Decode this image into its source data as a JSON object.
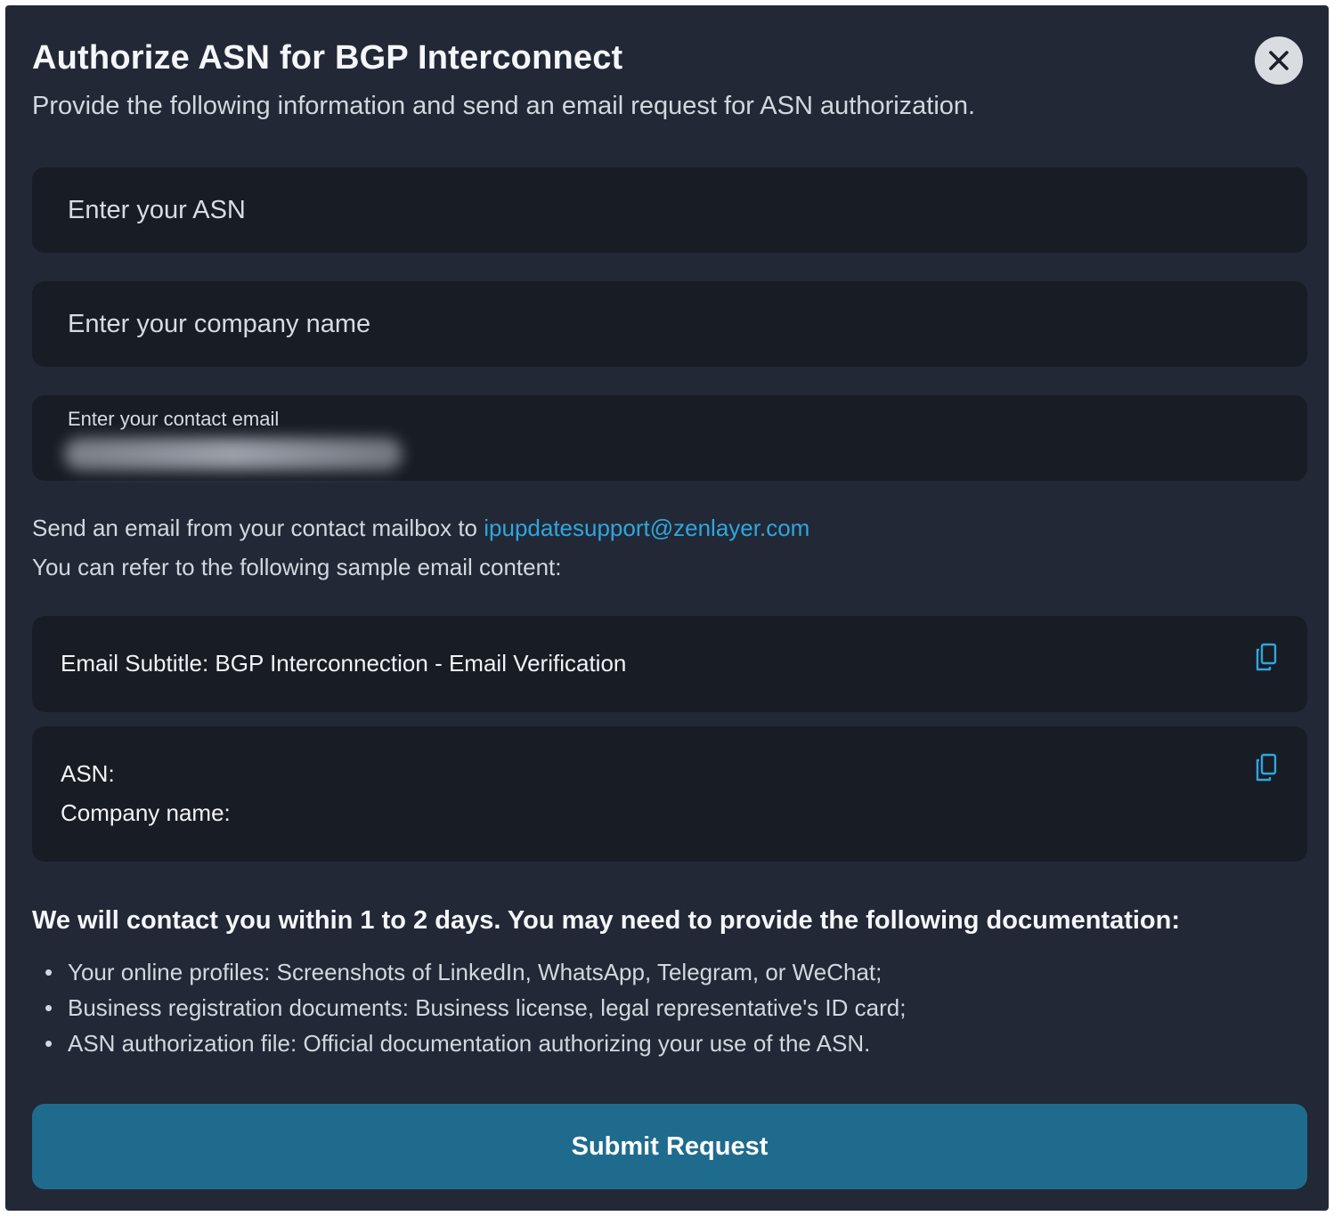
{
  "dialog": {
    "title": "Authorize ASN for BGP Interconnect",
    "subtitle": "Provide the following information and send an email request for ASN authorization.",
    "close_icon": "close-icon"
  },
  "form": {
    "asn": {
      "placeholder": "Enter your ASN",
      "value": ""
    },
    "company": {
      "placeholder": "Enter your company name",
      "value": ""
    },
    "email": {
      "label": "Enter your contact email",
      "value_state": "blurred"
    }
  },
  "instructions": {
    "send_prefix": "Send an email from your contact mailbox to ",
    "support_email": "ipupdatesupport@zenlayer.com",
    "refer_text": "You can refer to the following sample email content:"
  },
  "samples": {
    "subject_line": "Email Subtitle: BGP Interconnection - Email Verification",
    "body_line_1": "ASN:",
    "body_line_2": "Company name:",
    "copy_icon": "copy-icon"
  },
  "documentation": {
    "notice": "We will contact you within 1 to 2 days. You may need to provide the following documentation:",
    "items": [
      "Your online profiles: Screenshots of LinkedIn, WhatsApp, Telegram, or WeChat;",
      "Business registration documents: Business license, legal representative's ID card;",
      "ASN authorization file: Official documentation authorizing your use of the ASN."
    ],
    "bullet": "•"
  },
  "actions": {
    "submit_label": "Submit Request"
  },
  "colors": {
    "modal_bg": "#222836",
    "field_bg": "#181c25",
    "link": "#2fa6dd",
    "submit_bg": "#1f6b8e"
  }
}
